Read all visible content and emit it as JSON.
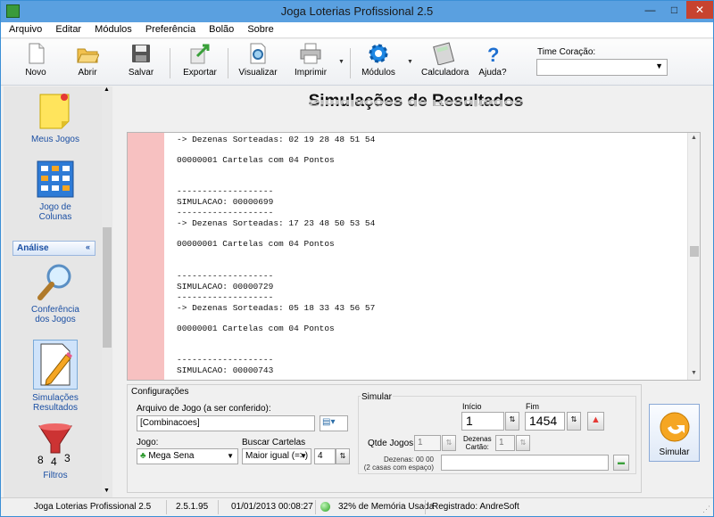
{
  "window": {
    "title": "Joga Loterias Profissional 2.5"
  },
  "menu": [
    "Arquivo",
    "Editar",
    "Módulos",
    "Preferência",
    "Bolão",
    "Sobre"
  ],
  "toolbar": {
    "novo": "Novo",
    "abrir": "Abrir",
    "salvar": "Salvar",
    "exportar": "Exportar",
    "visualizar": "Visualizar",
    "imprimir": "Imprimir",
    "modulos": "Módulos",
    "calculadora": "Calculadora",
    "ajuda": "Ajuda?",
    "time_label": "Time Coração:",
    "time_value": ""
  },
  "sidebar": {
    "meus_jogos": "Meus Jogos",
    "jogo_colunas_1": "Jogo de",
    "jogo_colunas_2": "Colunas",
    "section": "Análise",
    "conferencia_1": "Conferência",
    "conferencia_2": "dos Jogos",
    "simulacoes_1": "Simulações",
    "simulacoes_2": "Resultados",
    "filtros": "Filtros"
  },
  "main": {
    "title": "Simulações de Resultados",
    "output_lines": [
      "-> Dezenas Sorteadas: 02 19 28 48 51 54",
      "00000001 Cartelas com 04 Pontos",
      "-------------------",
      "SIMULACAO: 00000699",
      "-------------------",
      "-> Dezenas Sorteadas: 17 23 48 50 53 54",
      "00000001 Cartelas com 04 Pontos",
      "-------------------",
      "SIMULACAO: 00000729",
      "-------------------",
      "-> Dezenas Sorteadas: 05 18 33 43 56 57",
      "00000001 Cartelas com 04 Pontos",
      "-------------------",
      "SIMULACAO: 00000743"
    ]
  },
  "config": {
    "legend": "Configurações",
    "arquivo_label": "Arquivo de Jogo (a ser conferido):",
    "arquivo_value": "[Combinacoes]",
    "jogo_label": "Jogo:",
    "jogo_value": "Mega Sena",
    "buscar_label": "Buscar Cartelas",
    "buscar_value": "Maior igual (=>)",
    "buscar_num": "4"
  },
  "simular": {
    "legend": "Simular",
    "inicio_label": "Início",
    "inicio_value": "1",
    "fim_label": "Fim",
    "fim_value": "1454",
    "qtde_label": "Qtde Jogos",
    "qtde_value": "1",
    "dezenas_cartao_label_1": "Dezenas",
    "dezenas_cartao_label_2": "Cartão:",
    "dezenas_cartao_value": "1",
    "dezenas_info_1": "Dezenas: 00 00",
    "dezenas_info_2": "(2 casas com espaço)",
    "dezenas_value": "",
    "button": "Simular"
  },
  "status": {
    "app": "Joga Loterias Profissional 2.5",
    "version": "2.5.1.95",
    "datetime": "01/01/2013 00:08:27",
    "memory": "32% de Memória Usada",
    "registered": "Registrado: AndreSoft"
  }
}
